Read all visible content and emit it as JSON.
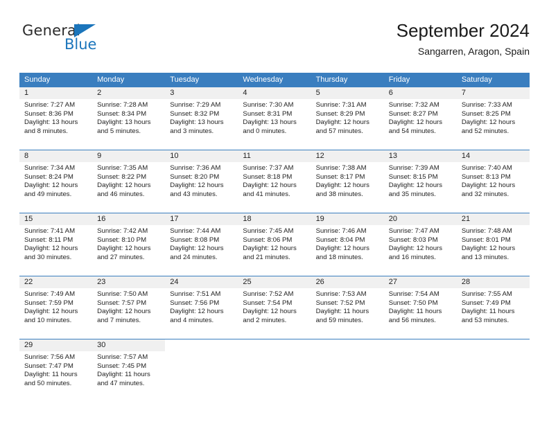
{
  "brand": {
    "name_top": "General",
    "name_bottom": "Blue",
    "accent_color": "#1b75bb"
  },
  "header": {
    "title": "September 2024",
    "subtitle": "Sangarren, Aragon, Spain"
  },
  "calendar": {
    "header_bg": "#3a7ebf",
    "day_band_bg": "#f0f0f0",
    "weekdays": [
      "Sunday",
      "Monday",
      "Tuesday",
      "Wednesday",
      "Thursday",
      "Friday",
      "Saturday"
    ],
    "weeks": [
      [
        {
          "date": "1",
          "sunrise": "Sunrise: 7:27 AM",
          "sunset": "Sunset: 8:36 PM",
          "daylight": "Daylight: 13 hours and 8 minutes."
        },
        {
          "date": "2",
          "sunrise": "Sunrise: 7:28 AM",
          "sunset": "Sunset: 8:34 PM",
          "daylight": "Daylight: 13 hours and 5 minutes."
        },
        {
          "date": "3",
          "sunrise": "Sunrise: 7:29 AM",
          "sunset": "Sunset: 8:32 PM",
          "daylight": "Daylight: 13 hours and 3 minutes."
        },
        {
          "date": "4",
          "sunrise": "Sunrise: 7:30 AM",
          "sunset": "Sunset: 8:31 PM",
          "daylight": "Daylight: 13 hours and 0 minutes."
        },
        {
          "date": "5",
          "sunrise": "Sunrise: 7:31 AM",
          "sunset": "Sunset: 8:29 PM",
          "daylight": "Daylight: 12 hours and 57 minutes."
        },
        {
          "date": "6",
          "sunrise": "Sunrise: 7:32 AM",
          "sunset": "Sunset: 8:27 PM",
          "daylight": "Daylight: 12 hours and 54 minutes."
        },
        {
          "date": "7",
          "sunrise": "Sunrise: 7:33 AM",
          "sunset": "Sunset: 8:25 PM",
          "daylight": "Daylight: 12 hours and 52 minutes."
        }
      ],
      [
        {
          "date": "8",
          "sunrise": "Sunrise: 7:34 AM",
          "sunset": "Sunset: 8:24 PM",
          "daylight": "Daylight: 12 hours and 49 minutes."
        },
        {
          "date": "9",
          "sunrise": "Sunrise: 7:35 AM",
          "sunset": "Sunset: 8:22 PM",
          "daylight": "Daylight: 12 hours and 46 minutes."
        },
        {
          "date": "10",
          "sunrise": "Sunrise: 7:36 AM",
          "sunset": "Sunset: 8:20 PM",
          "daylight": "Daylight: 12 hours and 43 minutes."
        },
        {
          "date": "11",
          "sunrise": "Sunrise: 7:37 AM",
          "sunset": "Sunset: 8:18 PM",
          "daylight": "Daylight: 12 hours and 41 minutes."
        },
        {
          "date": "12",
          "sunrise": "Sunrise: 7:38 AM",
          "sunset": "Sunset: 8:17 PM",
          "daylight": "Daylight: 12 hours and 38 minutes."
        },
        {
          "date": "13",
          "sunrise": "Sunrise: 7:39 AM",
          "sunset": "Sunset: 8:15 PM",
          "daylight": "Daylight: 12 hours and 35 minutes."
        },
        {
          "date": "14",
          "sunrise": "Sunrise: 7:40 AM",
          "sunset": "Sunset: 8:13 PM",
          "daylight": "Daylight: 12 hours and 32 minutes."
        }
      ],
      [
        {
          "date": "15",
          "sunrise": "Sunrise: 7:41 AM",
          "sunset": "Sunset: 8:11 PM",
          "daylight": "Daylight: 12 hours and 30 minutes."
        },
        {
          "date": "16",
          "sunrise": "Sunrise: 7:42 AM",
          "sunset": "Sunset: 8:10 PM",
          "daylight": "Daylight: 12 hours and 27 minutes."
        },
        {
          "date": "17",
          "sunrise": "Sunrise: 7:44 AM",
          "sunset": "Sunset: 8:08 PM",
          "daylight": "Daylight: 12 hours and 24 minutes."
        },
        {
          "date": "18",
          "sunrise": "Sunrise: 7:45 AM",
          "sunset": "Sunset: 8:06 PM",
          "daylight": "Daylight: 12 hours and 21 minutes."
        },
        {
          "date": "19",
          "sunrise": "Sunrise: 7:46 AM",
          "sunset": "Sunset: 8:04 PM",
          "daylight": "Daylight: 12 hours and 18 minutes."
        },
        {
          "date": "20",
          "sunrise": "Sunrise: 7:47 AM",
          "sunset": "Sunset: 8:03 PM",
          "daylight": "Daylight: 12 hours and 16 minutes."
        },
        {
          "date": "21",
          "sunrise": "Sunrise: 7:48 AM",
          "sunset": "Sunset: 8:01 PM",
          "daylight": "Daylight: 12 hours and 13 minutes."
        }
      ],
      [
        {
          "date": "22",
          "sunrise": "Sunrise: 7:49 AM",
          "sunset": "Sunset: 7:59 PM",
          "daylight": "Daylight: 12 hours and 10 minutes."
        },
        {
          "date": "23",
          "sunrise": "Sunrise: 7:50 AM",
          "sunset": "Sunset: 7:57 PM",
          "daylight": "Daylight: 12 hours and 7 minutes."
        },
        {
          "date": "24",
          "sunrise": "Sunrise: 7:51 AM",
          "sunset": "Sunset: 7:56 PM",
          "daylight": "Daylight: 12 hours and 4 minutes."
        },
        {
          "date": "25",
          "sunrise": "Sunrise: 7:52 AM",
          "sunset": "Sunset: 7:54 PM",
          "daylight": "Daylight: 12 hours and 2 minutes."
        },
        {
          "date": "26",
          "sunrise": "Sunrise: 7:53 AM",
          "sunset": "Sunset: 7:52 PM",
          "daylight": "Daylight: 11 hours and 59 minutes."
        },
        {
          "date": "27",
          "sunrise": "Sunrise: 7:54 AM",
          "sunset": "Sunset: 7:50 PM",
          "daylight": "Daylight: 11 hours and 56 minutes."
        },
        {
          "date": "28",
          "sunrise": "Sunrise: 7:55 AM",
          "sunset": "Sunset: 7:49 PM",
          "daylight": "Daylight: 11 hours and 53 minutes."
        }
      ],
      [
        {
          "date": "29",
          "sunrise": "Sunrise: 7:56 AM",
          "sunset": "Sunset: 7:47 PM",
          "daylight": "Daylight: 11 hours and 50 minutes."
        },
        {
          "date": "30",
          "sunrise": "Sunrise: 7:57 AM",
          "sunset": "Sunset: 7:45 PM",
          "daylight": "Daylight: 11 hours and 47 minutes."
        },
        {
          "date": "",
          "sunrise": "",
          "sunset": "",
          "daylight": ""
        },
        {
          "date": "",
          "sunrise": "",
          "sunset": "",
          "daylight": ""
        },
        {
          "date": "",
          "sunrise": "",
          "sunset": "",
          "daylight": ""
        },
        {
          "date": "",
          "sunrise": "",
          "sunset": "",
          "daylight": ""
        },
        {
          "date": "",
          "sunrise": "",
          "sunset": "",
          "daylight": ""
        }
      ]
    ]
  }
}
